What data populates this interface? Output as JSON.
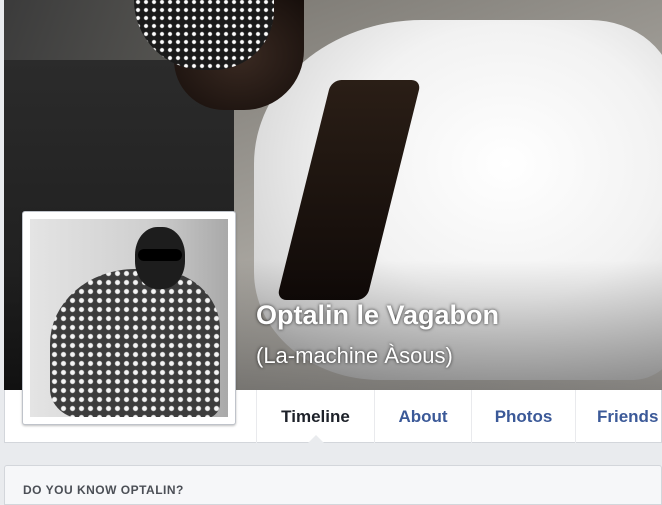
{
  "profile": {
    "name": "Optalin le Vagabon",
    "alternate_name": "(La-machine Àsous)"
  },
  "tabs": [
    {
      "label": "Timeline",
      "active": true
    },
    {
      "label": "About",
      "active": false
    },
    {
      "label": "Photos",
      "active": false
    },
    {
      "label": "Friends",
      "active": false
    }
  ],
  "suggestion": {
    "title": "DO YOU KNOW OPTALIN?"
  },
  "colors": {
    "link": "#3b5998",
    "active_tab": "#1d2129",
    "page_background": "#e9ebee"
  }
}
